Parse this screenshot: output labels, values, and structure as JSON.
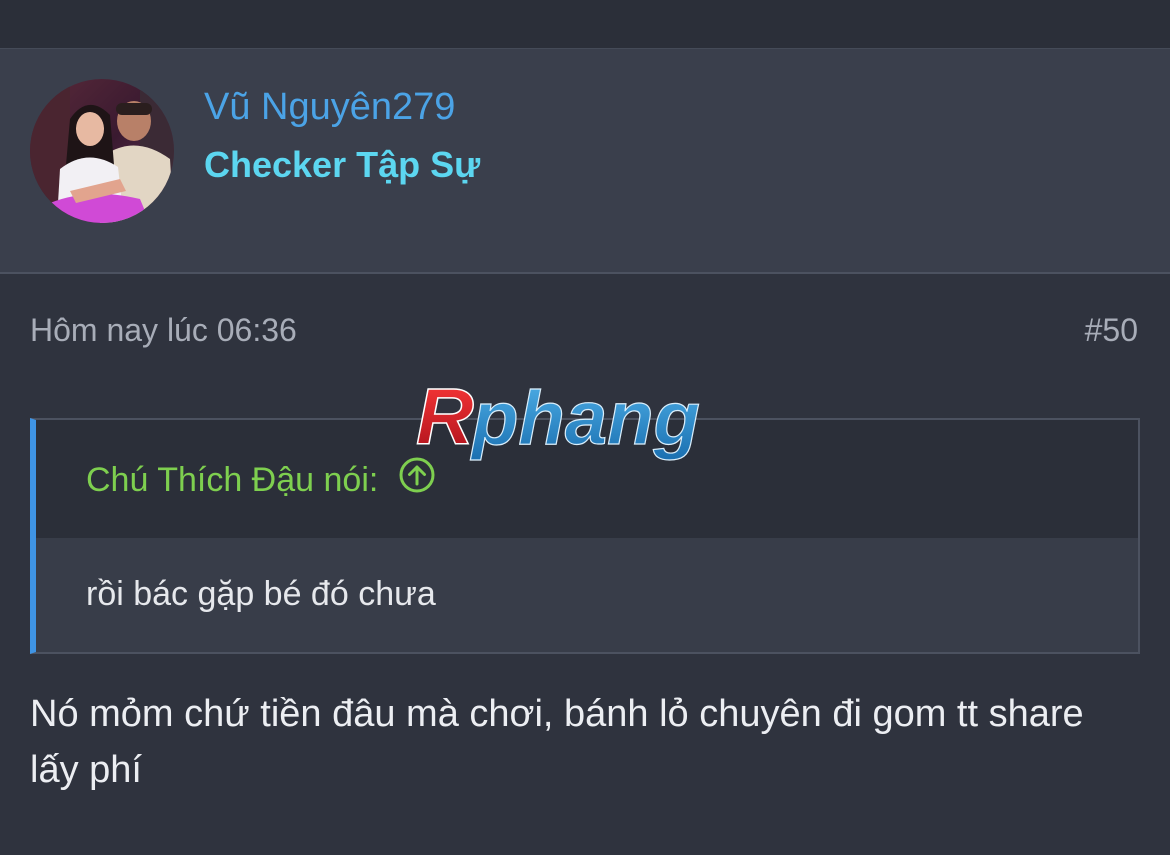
{
  "user": {
    "name": "Vũ Nguyên279",
    "title": "Checker Tập Sự"
  },
  "post": {
    "date": "Hôm nay lúc 06:36",
    "number": "#50",
    "body": "Nó mỏm chứ tiền đâu mà chơi, bánh lỏ chuyên đi gom tt share lấy phí"
  },
  "quote": {
    "author": "Chú Thích Đậu nói:",
    "text": "rồi bác gặp bé đó chưa"
  },
  "watermark": {
    "text": "Rphang"
  },
  "colors": {
    "background": "#2f333e",
    "header": "#3a3f4c",
    "username": "#4ba3e6",
    "user_title": "#5cd6f0",
    "quote_author": "#7ecf4f",
    "quote_border": "#3f94e4"
  },
  "icons": {
    "quote_jump": "arrow-up-circle-icon"
  }
}
